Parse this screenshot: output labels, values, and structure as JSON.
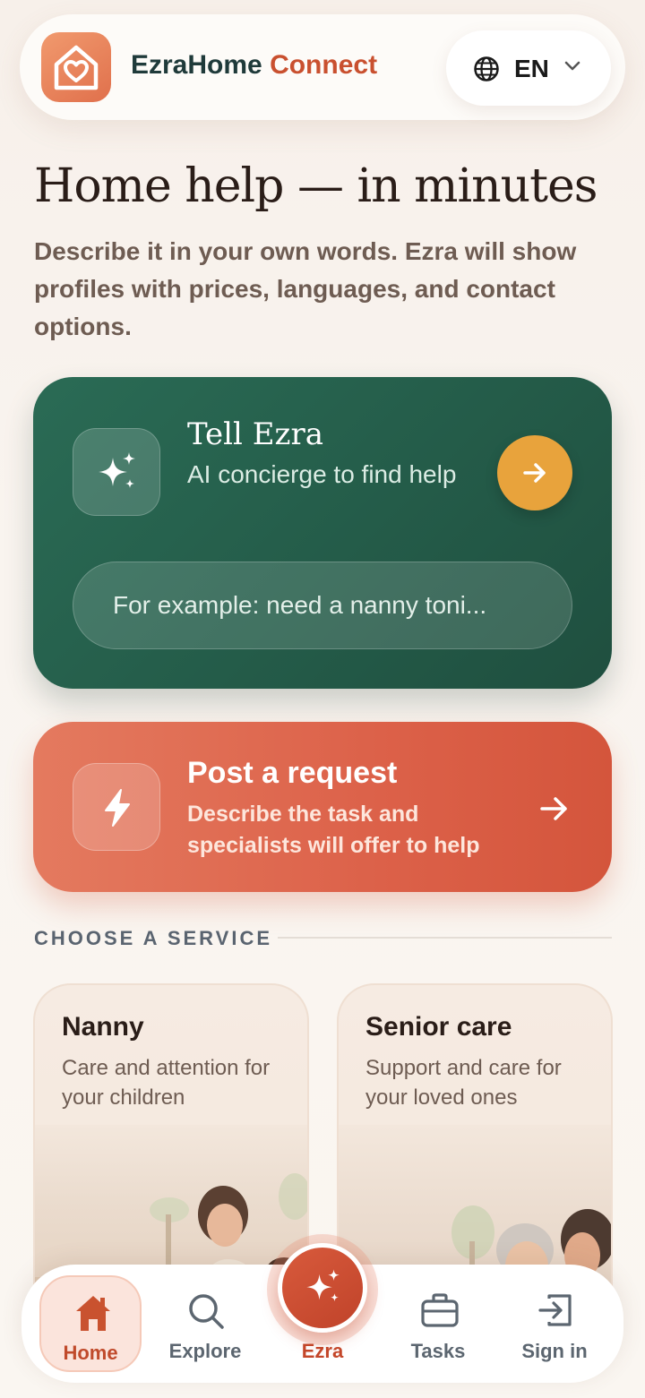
{
  "header": {
    "brand_primary": "EzraHome",
    "brand_accent": "Connect",
    "language_code": "EN",
    "logo_icon": "house-heart-icon",
    "globe_icon": "globe-icon",
    "chevron_icon": "chevron-down-icon"
  },
  "hero": {
    "title": "Home help — in minutes",
    "subtitle": "Describe it in your own words. Ezra will show profiles with prices, languages, and contact options."
  },
  "ezra_card": {
    "title": "Tell Ezra",
    "subtitle": "AI concierge to find help",
    "input_placeholder": "For example: need a nanny toni...",
    "icon": "sparkles-icon",
    "go_icon": "arrow-right-icon"
  },
  "post_card": {
    "title": "Post a request",
    "subtitle": "Describe the task and specialists will offer to help",
    "icon": "lightning-icon"
  },
  "services": {
    "section_label": "CHOOSE A SERVICE",
    "items": [
      {
        "title": "Nanny",
        "description": "Care and attention for your children"
      },
      {
        "title": "Senior care",
        "description": "Support and care for your loved ones"
      }
    ]
  },
  "nav": {
    "items": [
      {
        "label": "Home",
        "icon": "home-icon",
        "active": true
      },
      {
        "label": "Explore",
        "icon": "search-icon"
      },
      {
        "label": "Ezra",
        "icon": "sparkles-icon"
      },
      {
        "label": "Tasks",
        "icon": "briefcase-icon"
      },
      {
        "label": "Sign in",
        "icon": "sign-in-icon"
      }
    ]
  },
  "colors": {
    "brand_accent": "#c9502f",
    "ezra_green": "#245c4a",
    "go_button": "#e8a33c",
    "post_coral": "#dc6149",
    "nav_active": "#c04a2b"
  }
}
